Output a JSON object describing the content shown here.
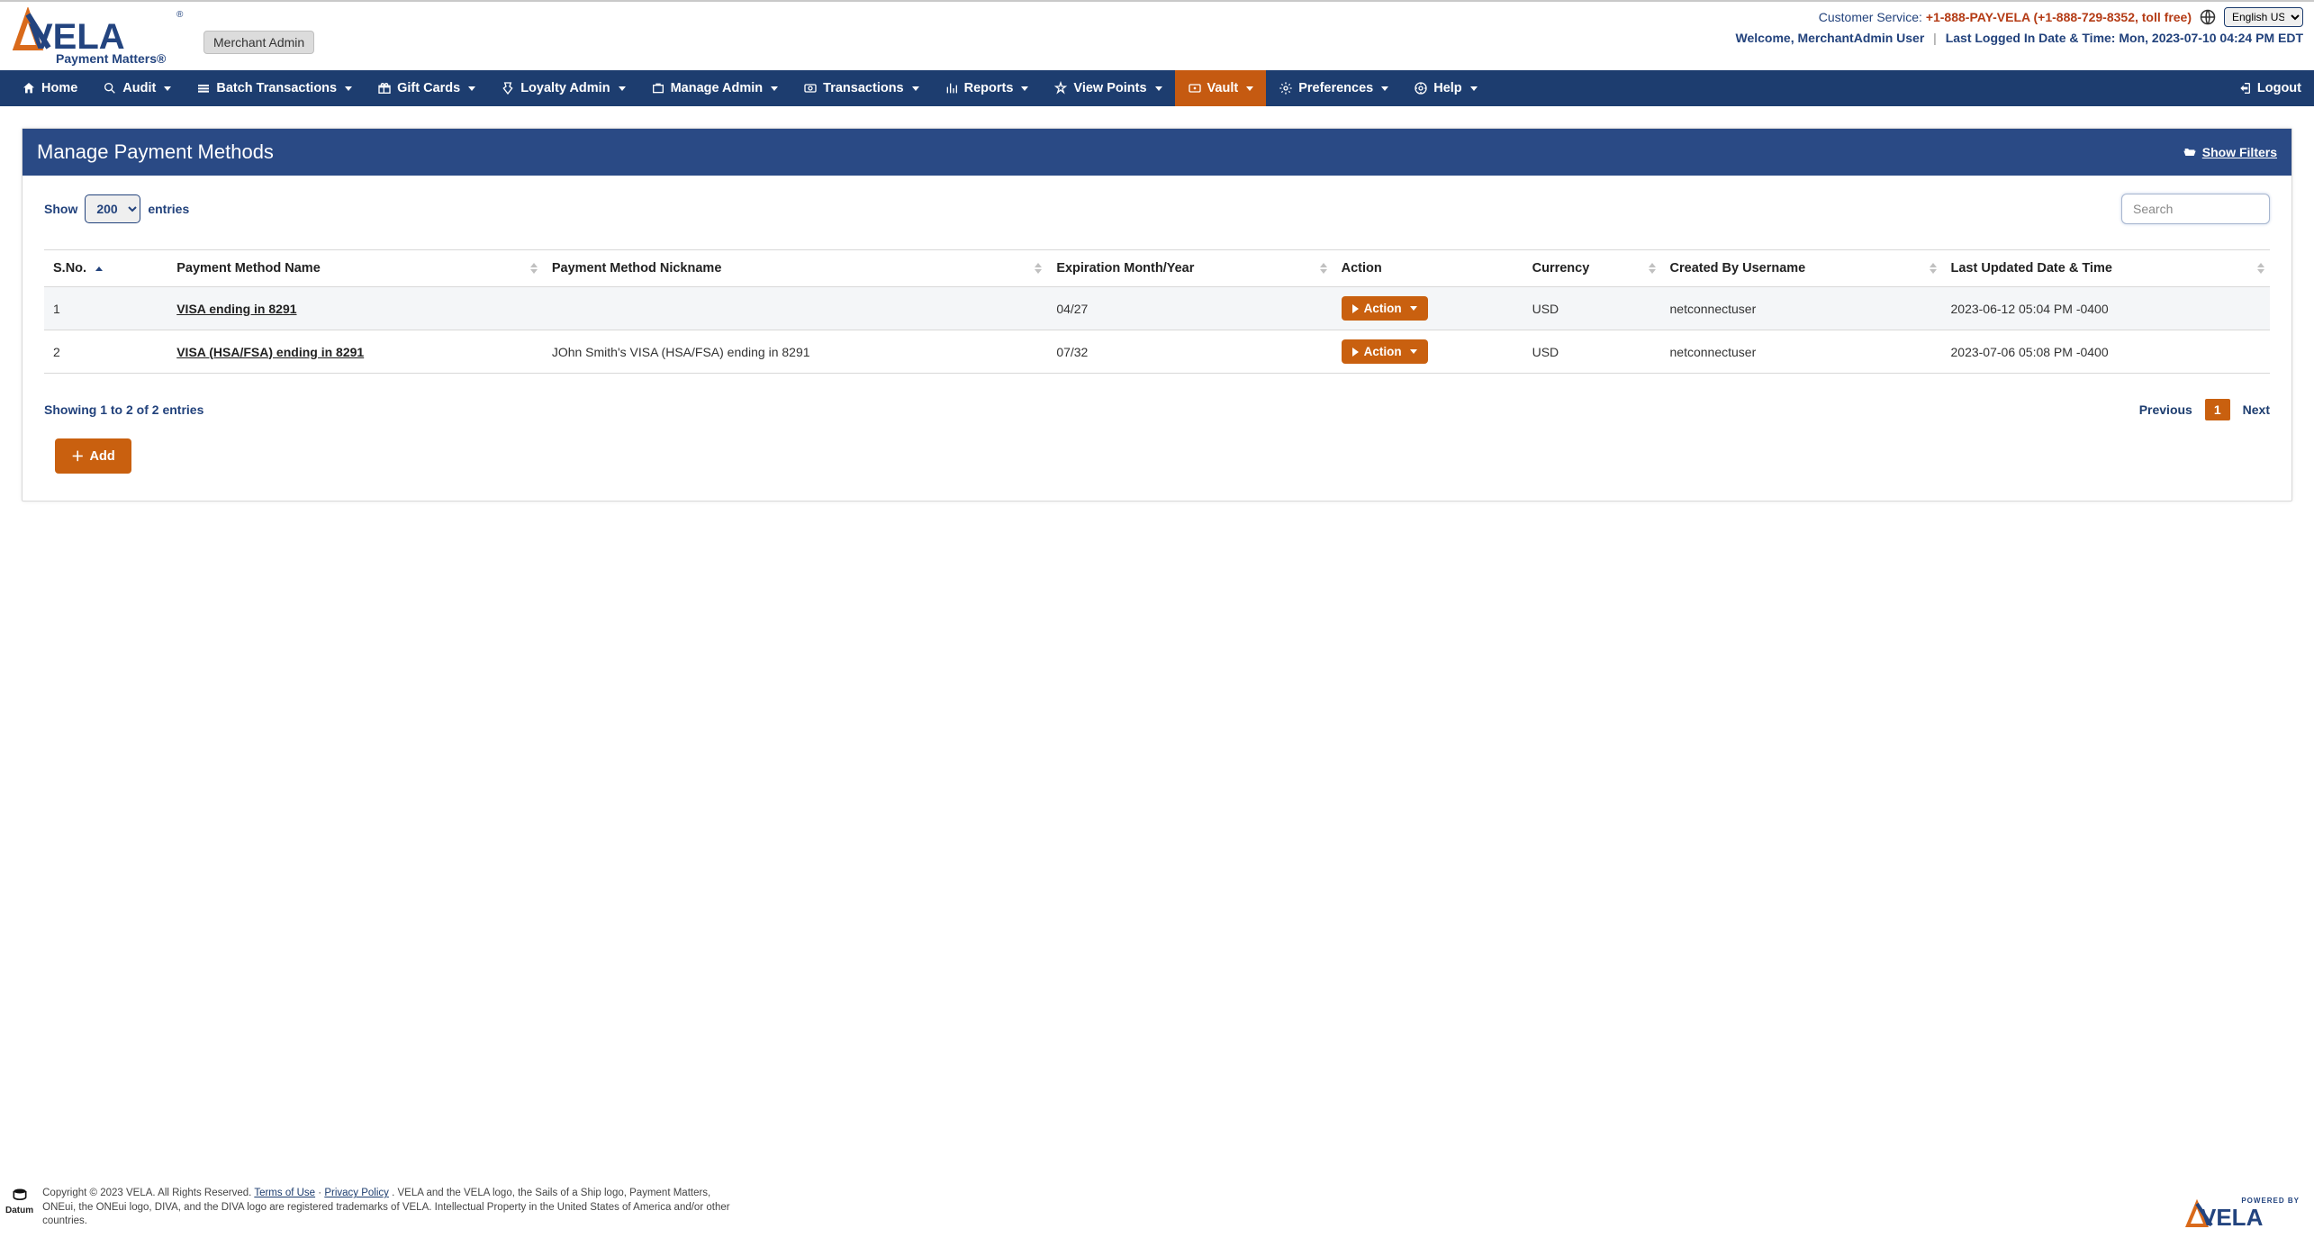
{
  "top": {
    "brandName": "VELA",
    "brandTagline": "Payment Matters®",
    "roleBadge": "Merchant Admin",
    "customerServiceLabel": "Customer Service: ",
    "customerServicePhone": "+1-888-PAY-VELA (+1-888-729-8352, toll free)",
    "languageValue": "English US",
    "welcome": "Welcome, MerchantAdmin User",
    "lastLoggedLabel": "Last Logged In Date & Time: ",
    "lastLogged": "Mon, 2023-07-10 04:24 PM EDT"
  },
  "nav": {
    "items": [
      {
        "label": "Home",
        "caret": false
      },
      {
        "label": "Audit",
        "caret": true
      },
      {
        "label": "Batch Transactions",
        "caret": true
      },
      {
        "label": "Gift Cards",
        "caret": true
      },
      {
        "label": "Loyalty Admin",
        "caret": true
      },
      {
        "label": "Manage Admin",
        "caret": true
      },
      {
        "label": "Transactions",
        "caret": true
      },
      {
        "label": "Reports",
        "caret": true
      },
      {
        "label": "View Points",
        "caret": true
      },
      {
        "label": "Vault",
        "caret": true,
        "active": true
      },
      {
        "label": "Preferences",
        "caret": true
      },
      {
        "label": "Help",
        "caret": true
      }
    ],
    "logout": "Logout"
  },
  "page": {
    "title": "Manage Payment Methods",
    "showFilters": "Show Filters",
    "showLabel": "Show",
    "entriesLabel": "entries",
    "entriesValue": "200",
    "searchPlaceholder": "Search",
    "columns": [
      "S.No.",
      "Payment Method Name",
      "Payment Method Nickname",
      "Expiration Month/Year",
      "Action",
      "Currency",
      "Created By Username",
      "Last Updated Date & Time"
    ],
    "rows": [
      {
        "sno": "1",
        "name": "VISA ending in 8291",
        "nickname": "",
        "exp": "04/27",
        "currency": "USD",
        "createdBy": "netconnectuser",
        "updated": "2023-06-12 05:04 PM -0400"
      },
      {
        "sno": "2",
        "name": "VISA (HSA/FSA) ending in 8291",
        "nickname": "JOhn Smith's VISA (HSA/FSA) ending in 8291",
        "exp": "07/32",
        "currency": "USD",
        "createdBy": "netconnectuser",
        "updated": "2023-07-06 05:08 PM -0400"
      }
    ],
    "info": "Showing 1 to 2 of 2 entries",
    "prev": "Previous",
    "next": "Next",
    "pageNum": "1",
    "actionLabel": "Action",
    "addLabel": "Add"
  },
  "footer": {
    "copyrightPrefix": "Copyright © 2023 VELA. All Rights Reserved. ",
    "terms": "Terms of Use",
    "dot": " · ",
    "privacy": "Privacy Policy",
    "disclaimer": ". VELA and the VELA logo, the Sails of a Ship logo, Payment Matters, ONEui, the ONEui logo, DIVA, and the DIVA logo are registered trademarks of VELA. Intellectual Property in the United States of America and/or other countries.",
    "datum": "Datum",
    "poweredBy": "POWERED BY",
    "poweredBrand": "VELA"
  }
}
